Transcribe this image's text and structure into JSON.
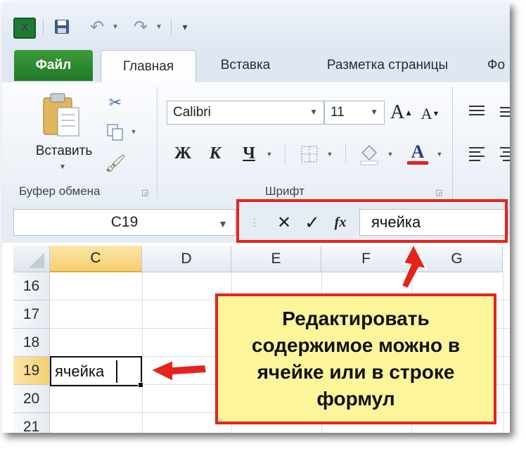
{
  "qat": {
    "icons": [
      "excel-logo-icon",
      "save-icon",
      "undo-icon",
      "redo-icon",
      "customize-qat-icon"
    ]
  },
  "tabs": [
    {
      "label": "Файл"
    },
    {
      "label": "Главная"
    },
    {
      "label": "Вставка"
    },
    {
      "label": "Разметка страницы"
    },
    {
      "label": "Фо"
    }
  ],
  "ribbon": {
    "clipboard": {
      "paste_label": "Вставить",
      "group_label": "Буфер обмена"
    },
    "font": {
      "font_name": "Calibri",
      "font_size": "11",
      "bold": "Ж",
      "italic": "К",
      "underline": "Ч",
      "grow_label": "A",
      "shrink_label": "A",
      "color_label": "A",
      "group_label": "Шрифт"
    }
  },
  "formula_bar": {
    "name_box": "C19",
    "cancel": "✕",
    "enter": "✓",
    "fx": "fx",
    "content": "ячейка"
  },
  "grid": {
    "columns": [
      "C",
      "D",
      "E",
      "F",
      "G"
    ],
    "rows": [
      "16",
      "17",
      "18",
      "19",
      "20",
      "21"
    ],
    "active_cell_value": "ячейка"
  },
  "callout": {
    "text": "Редактировать\nсодержимое можно в\nячейке или в строке\nформул"
  },
  "colors": {
    "accent_red": "#e5231c",
    "callout_bg": "#fdf59a",
    "file_tab": "#2a8a2f"
  }
}
